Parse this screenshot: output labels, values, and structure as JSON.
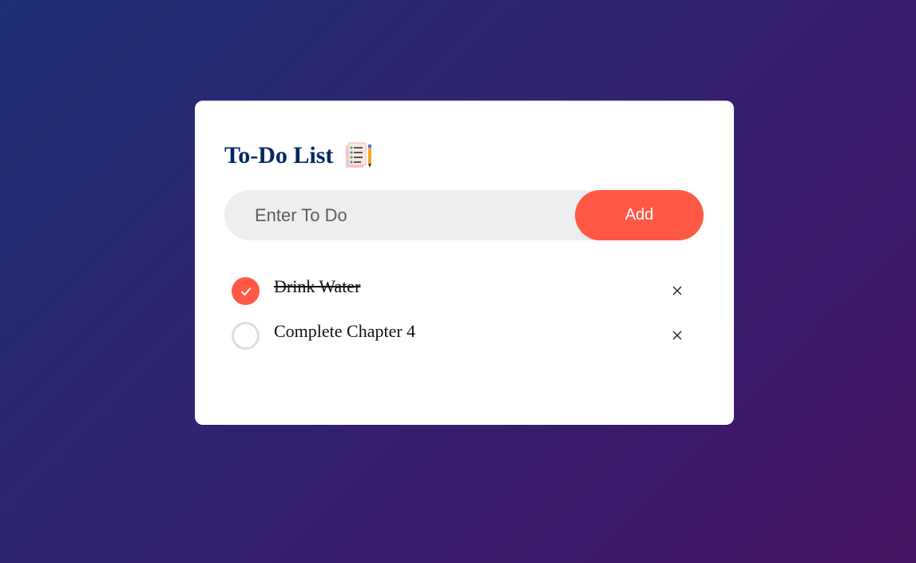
{
  "header": {
    "title": "To-Do List",
    "icon": "clipboard-checklist-icon"
  },
  "input": {
    "placeholder": "Enter To Do",
    "value": ""
  },
  "add_button": {
    "label": "Add"
  },
  "todos": [
    {
      "text": "Drink Water",
      "completed": true,
      "remove_icon": "close-icon"
    },
    {
      "text": "Complete Chapter 4",
      "completed": false,
      "remove_icon": "close-icon"
    }
  ],
  "colors": {
    "accent": "#ff5945",
    "title": "#002765",
    "input_bg": "#edeef0",
    "card_bg": "#ffffff",
    "bg_gradient_start": "#1f2f76",
    "bg_gradient_end": "#44125f"
  }
}
